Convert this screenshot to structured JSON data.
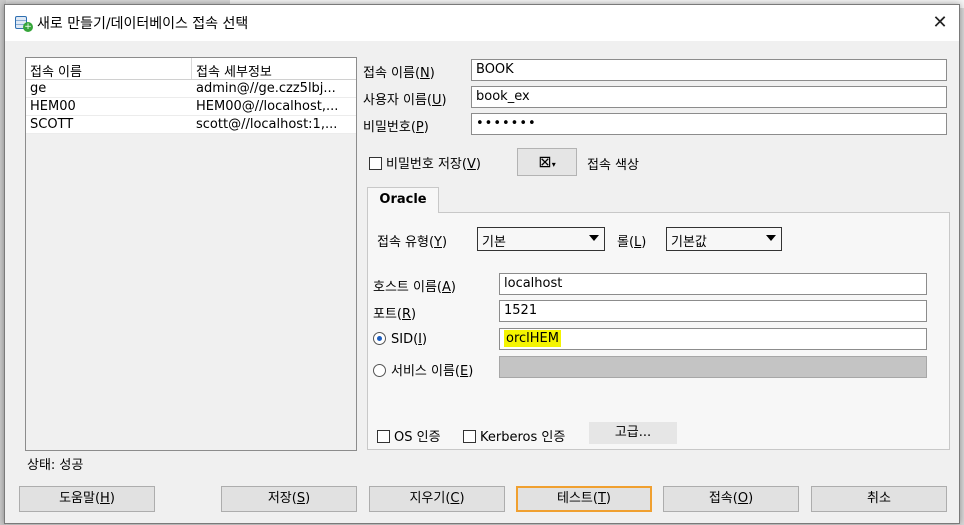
{
  "dialog": {
    "title": "새로 만들기/데이터베이스 접속 선택",
    "close_glyph": "✕"
  },
  "connections": {
    "headers": [
      "접속 이름",
      "접속 세부정보"
    ],
    "rows": [
      {
        "name": "ge",
        "detail": "admin@//ge.czz5lbj..."
      },
      {
        "name": "HEM00",
        "detail": "HEM00@//localhost,..."
      },
      {
        "name": "SCOTT",
        "detail": "scott@//localhost:1,..."
      }
    ]
  },
  "status": "상태: 성공",
  "form": {
    "conn_name_label": "접속 이름(",
    "conn_name_key": "N",
    "conn_name_value": "BOOK",
    "user_label": "사용자 이름(",
    "user_key": "U",
    "user_value": "book_ex",
    "pw_label": "비밀번호(",
    "pw_key": "P",
    "pw_value": "•••••••",
    "save_pw_label": "비밀번호 저장(",
    "save_pw_key": "V",
    "conn_color_label": "접속 색상"
  },
  "oracle_tab": {
    "tab_label": "Oracle",
    "conn_type_label": "접속 유형(",
    "conn_type_key": "Y",
    "conn_type_value": "기본",
    "role_label": "롤(",
    "role_key": "L",
    "role_value": "기본값",
    "host_label": "호스트 이름(",
    "host_key": "A",
    "host_value": "localhost",
    "port_label": "포트(",
    "port_key": "R",
    "port_value": "1521",
    "sid_label": "SID(",
    "sid_key": "I",
    "sid_value": "orclHEM",
    "service_label": "서비스 이름(",
    "service_key": "E",
    "os_auth_label": "OS 인증",
    "kerberos_label": "Kerberos 인증",
    "advanced_label": "고급..."
  },
  "buttons": {
    "help": "도움말(",
    "help_key": "H",
    "save": "저장(",
    "save_key": "S",
    "clear": "지우기(",
    "clear_key": "C",
    "test": "테스트(",
    "test_key": "T",
    "connect": "접속(",
    "connect_key": "O",
    "cancel": "취소"
  },
  "colors": {
    "highlight": "#f4f400",
    "focus_border": "#f0a030"
  }
}
